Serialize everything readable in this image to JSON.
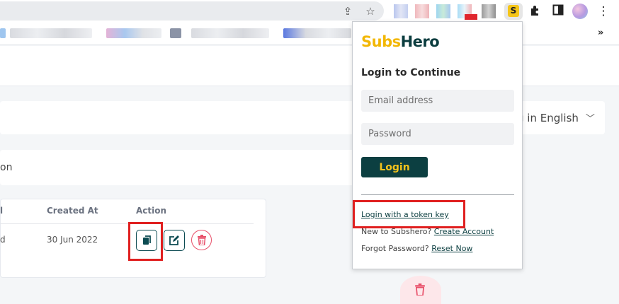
{
  "browser": {
    "share_icon": "share-icon",
    "bookmark_icon": "star-icon",
    "extension_label": "S",
    "puzzle_icon": "puzzle-icon",
    "sidepanel_icon": "side-panel-icon",
    "menu_icon": "kebab-menu-icon",
    "bookmarks_more": "»"
  },
  "page": {
    "language_label": "g in English",
    "row_partial_text": "on",
    "table": {
      "headers": [
        "Created At",
        "Action"
      ],
      "header_partial": "l",
      "rows": [
        {
          "partial": "d",
          "created_at": "30 Jun 2022"
        }
      ]
    }
  },
  "popup": {
    "brand_part1": "Subs",
    "brand_part2": "Hero",
    "title": "Login to Continue",
    "email_placeholder": "Email address",
    "password_placeholder": "Password",
    "login_label": "Login",
    "token_link": "Login with a token key",
    "new_prompt": "New to Subshero?",
    "create_account": "Create Account",
    "forgot_prompt": "Forgot Password?",
    "reset_now": "Reset Now"
  },
  "colors": {
    "brand_yellow": "#f2b705",
    "brand_dark": "#0c3f41",
    "highlight_red": "#e02020",
    "delete_red": "#e8506a"
  }
}
